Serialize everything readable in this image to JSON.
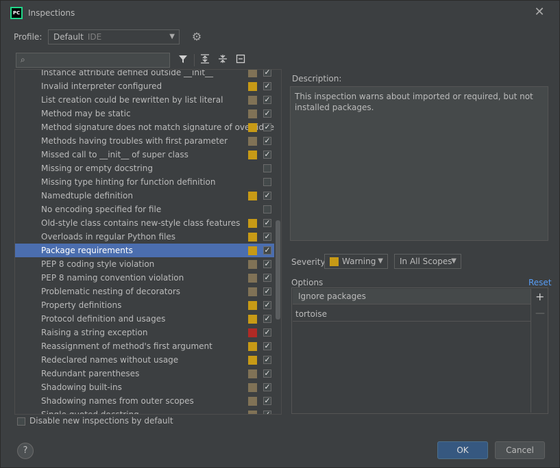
{
  "window": {
    "title": "Inspections",
    "app_icon_text": "PC"
  },
  "profile": {
    "label": "Profile:",
    "value": "Default",
    "tag": "IDE"
  },
  "colors": {
    "warning": "#c79a16",
    "weak_warning": "#807256",
    "error": "#b02a25",
    "selection": "#4b6eaf",
    "accent_link": "#589df6"
  },
  "tree": {
    "items": [
      {
        "label": "Instance attribute defined outside __init__",
        "severity": "weak",
        "checked": true
      },
      {
        "label": "Invalid interpreter configured",
        "severity": "warning",
        "checked": true
      },
      {
        "label": "List creation could be rewritten by list literal",
        "severity": "weak",
        "checked": true
      },
      {
        "label": "Method may be static",
        "severity": "weak",
        "checked": true
      },
      {
        "label": "Method signature does not match signature of overridde",
        "severity": "warning",
        "checked": true
      },
      {
        "label": "Methods having troubles with first parameter",
        "severity": "weak",
        "checked": true
      },
      {
        "label": "Missed call to __init__ of super class",
        "severity": "warning",
        "checked": true
      },
      {
        "label": "Missing or empty docstring",
        "severity": "none",
        "checked": false
      },
      {
        "label": "Missing type hinting for function definition",
        "severity": "none",
        "checked": false
      },
      {
        "label": "Namedtuple definition",
        "severity": "warning",
        "checked": true
      },
      {
        "label": "No encoding specified for file",
        "severity": "none",
        "checked": false
      },
      {
        "label": "Old-style class contains new-style class features",
        "severity": "warning",
        "checked": true
      },
      {
        "label": "Overloads in regular Python files",
        "severity": "warning",
        "checked": true
      },
      {
        "label": "Package requirements",
        "severity": "warning",
        "checked": true,
        "selected": true
      },
      {
        "label": "PEP 8 coding style violation",
        "severity": "weak",
        "checked": true
      },
      {
        "label": "PEP 8 naming convention violation",
        "severity": "weak",
        "checked": true
      },
      {
        "label": "Problematic nesting of decorators",
        "severity": "weak",
        "checked": true
      },
      {
        "label": "Property definitions",
        "severity": "warning",
        "checked": true
      },
      {
        "label": "Protocol definition and usages",
        "severity": "warning",
        "checked": true
      },
      {
        "label": "Raising a string exception",
        "severity": "error",
        "checked": true
      },
      {
        "label": "Reassignment of method's first argument",
        "severity": "warning",
        "checked": true
      },
      {
        "label": "Redeclared names without usage",
        "severity": "warning",
        "checked": true
      },
      {
        "label": "Redundant parentheses",
        "severity": "weak",
        "checked": true
      },
      {
        "label": "Shadowing built-ins",
        "severity": "weak",
        "checked": true
      },
      {
        "label": "Shadowing names from outer scopes",
        "severity": "weak",
        "checked": true
      },
      {
        "label": "Single quoted docstring",
        "severity": "weak",
        "checked": true
      }
    ]
  },
  "disable_new": {
    "label": "Disable new inspections by default",
    "checked": false
  },
  "description": {
    "label": "Description:",
    "text": "This inspection warns about imported or required, but not installed packages."
  },
  "severity": {
    "label": "Severity:",
    "value": "Warning",
    "scope": "In All Scopes"
  },
  "options": {
    "label": "Options",
    "reset": "Reset",
    "header": "Ignore packages",
    "rows": [
      "tortoise"
    ]
  },
  "buttons": {
    "help": "?",
    "ok": "OK",
    "cancel": "Cancel"
  }
}
